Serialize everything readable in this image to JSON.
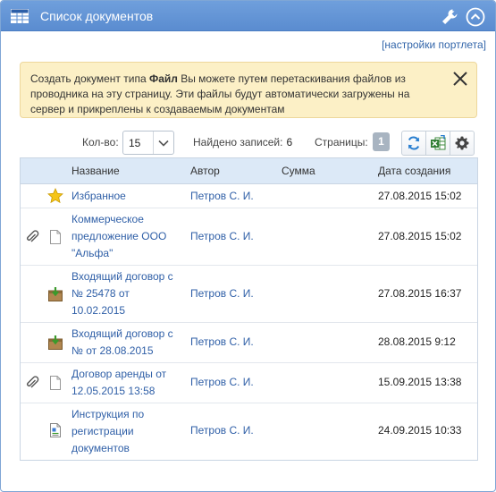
{
  "portlet": {
    "title": "Список документов",
    "settings_link": "[настройки портлета]"
  },
  "notice": {
    "prefix": "Создать документ типа ",
    "bold": "Файл",
    "text": " Вы можете путем перетаскивания файлов из проводника на эту страницу. Эти файлы будут автоматически загружены на сервер и прикреплены к создаваемым документам"
  },
  "toolbar": {
    "count_label": "Кол-во:",
    "count_value": "15",
    "found_label": "Найдено записей:",
    "found_value": "6",
    "pages_label": "Страницы:",
    "page": "1"
  },
  "table": {
    "columns": [
      "Название",
      "Автор",
      "Сумма",
      "Дата создания"
    ],
    "rows": [
      {
        "icon": "star-icon",
        "attachment": false,
        "name": "Избранное",
        "author": "Петров С. И.",
        "sum": "",
        "date": "27.08.2015 15:02"
      },
      {
        "icon": "document-icon",
        "attachment": true,
        "name": "Коммерческое предложение ООО \"Альфа\"",
        "author": "Петров С. И.",
        "sum": "",
        "date": "27.08.2015 15:02"
      },
      {
        "icon": "incoming-contract-icon",
        "attachment": false,
        "name": "Входящий договор с № 25478 от 10.02.2015",
        "author": "Петров С. И.",
        "sum": "",
        "date": "27.08.2015 16:37"
      },
      {
        "icon": "incoming-contract-icon",
        "attachment": false,
        "name": "Входящий договор с № от 28.08.2015",
        "author": "Петров С. И.",
        "sum": "",
        "date": "28.08.2015 9:12"
      },
      {
        "icon": "document-icon",
        "attachment": true,
        "name": "Договор аренды от 12.05.2015 13:58",
        "author": "Петров С. И.",
        "sum": "",
        "date": "15.09.2015 13:38"
      },
      {
        "icon": "instruction-icon",
        "attachment": false,
        "name": "Инструкция по регистрации документов",
        "author": "Петров С. И.",
        "sum": "",
        "date": "24.09.2015 10:33"
      }
    ]
  },
  "colors": {
    "titlebar": "#5a8cd0",
    "link": "#2f5fa7",
    "notice_bg": "#fcf0c6",
    "header_bg": "#dce9f7"
  }
}
